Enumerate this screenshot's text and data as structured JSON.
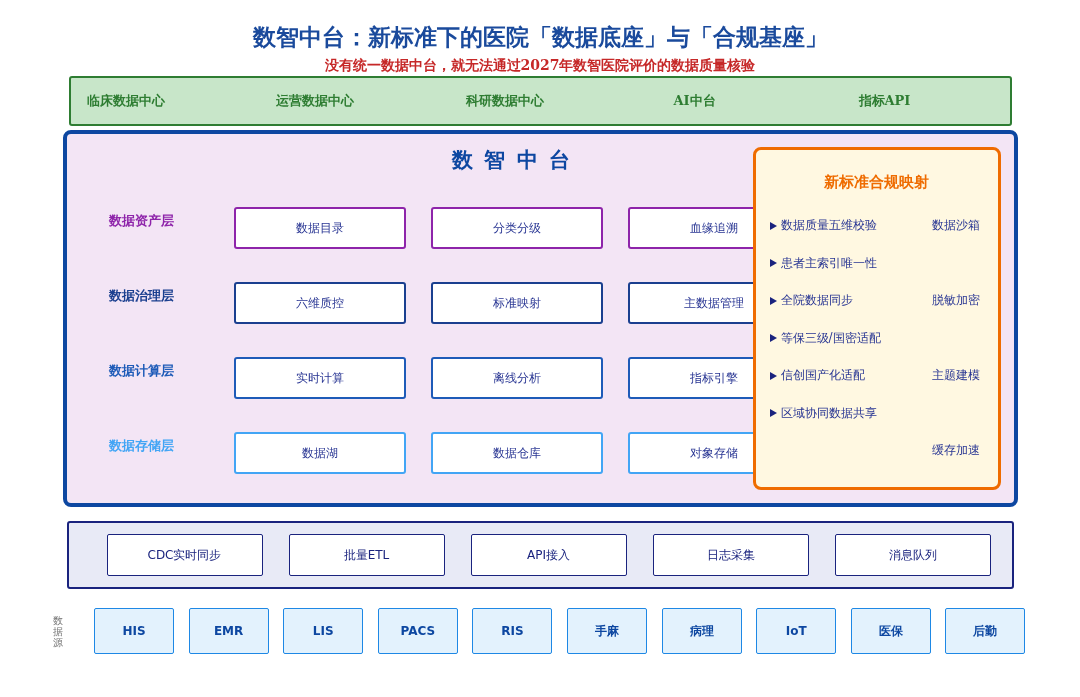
{
  "title": "数智中台：新标准下的医院「数据底座」与「合规基座」",
  "subtitle": "没有统一数据中台，就无法通过2027年数智医院评价的数据质量核验",
  "applications": [
    "临床数据中心",
    "运营数据中心",
    "科研数据中心",
    "AI中台",
    "指标API"
  ],
  "platform": {
    "title": "数 智 中 台",
    "layers": [
      {
        "name": "数据资产层",
        "color": "#8e24aa",
        "items": [
          "数据目录",
          "分类分级",
          "血缘追溯",
          "数据沙箱"
        ]
      },
      {
        "name": "数据治理层",
        "color": "#1a3f8f",
        "items": [
          "六维质控",
          "标准映射",
          "主数据管理",
          "脱敏加密"
        ]
      },
      {
        "name": "数据计算层",
        "color": "#1e5bb8",
        "items": [
          "实时计算",
          "离线分析",
          "指标引擎",
          "主题建模"
        ]
      },
      {
        "name": "数据存储层",
        "color": "#42a5f5",
        "items": [
          "数据湖",
          "数据仓库",
          "对象存储",
          "缓存加速"
        ]
      }
    ],
    "compliance": {
      "title": "新标准合规映射",
      "items": [
        "数据质量五维校验",
        "患者主索引唯一性",
        "全院数据同步",
        "等保三级/国密适配",
        "信创国产化适配",
        "区域协同数据共享"
      ]
    }
  },
  "ingestion": [
    "CDC实时同步",
    "批量ETL",
    "API接入",
    "日志采集",
    "消息队列"
  ],
  "sources": {
    "label": "数据源",
    "items": [
      "HIS",
      "EMR",
      "LIS",
      "PACS",
      "RIS",
      "手麻",
      "病理",
      "IoT",
      "医保",
      "后勤"
    ]
  }
}
